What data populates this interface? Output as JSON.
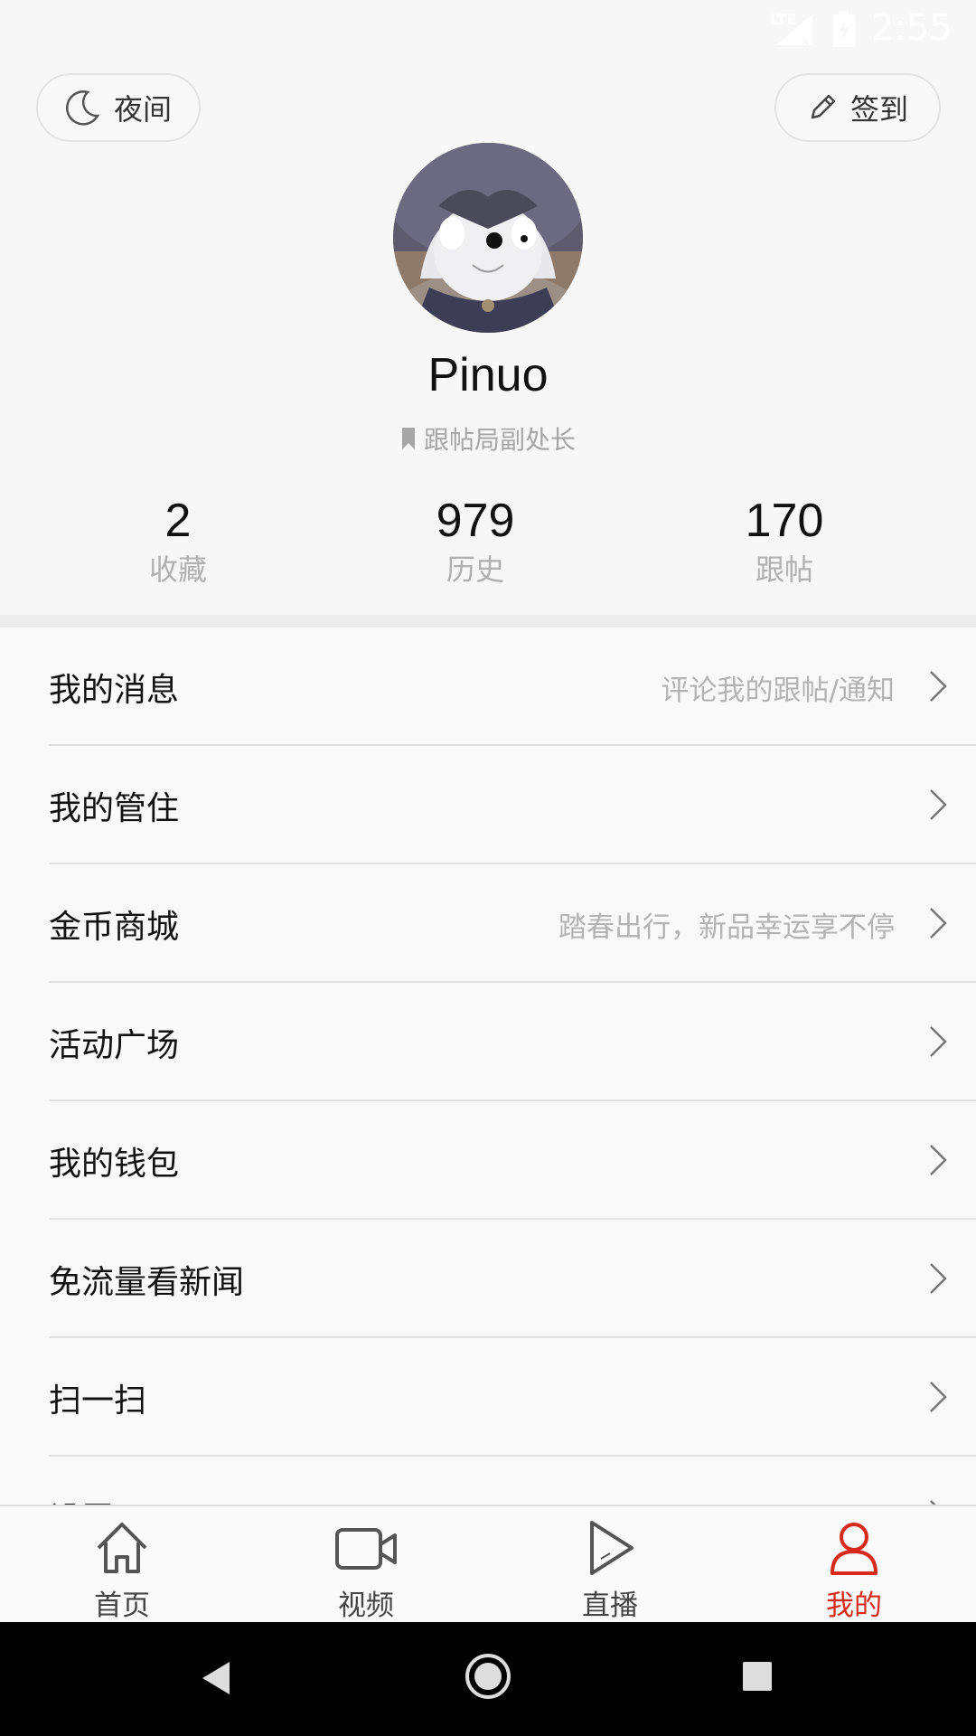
{
  "status_bar": {
    "network": "LTE",
    "time": "2:55"
  },
  "header": {
    "night_label": "夜间",
    "sign_in_label": "签到"
  },
  "profile": {
    "username": "Pinuo",
    "title": "跟帖局副处长"
  },
  "stats": [
    {
      "value": "2",
      "label": "收藏"
    },
    {
      "value": "979",
      "label": "历史"
    },
    {
      "value": "170",
      "label": "跟帖"
    }
  ],
  "menu": [
    {
      "label": "我的消息",
      "hint": "评论我的跟帖/通知"
    },
    {
      "label": "我的管住",
      "hint": ""
    },
    {
      "label": "金币商城",
      "hint": "踏春出行，新品幸运享不停"
    },
    {
      "label": "活动广场",
      "hint": ""
    },
    {
      "label": "我的钱包",
      "hint": ""
    },
    {
      "label": "免流量看新闻",
      "hint": ""
    },
    {
      "label": "扫一扫",
      "hint": ""
    },
    {
      "label": "设置",
      "hint": ""
    }
  ],
  "tabbar": [
    {
      "label": "首页",
      "icon": "home-icon"
    },
    {
      "label": "视频",
      "icon": "video-camera-icon"
    },
    {
      "label": "直播",
      "icon": "play-icon"
    },
    {
      "label": "我的",
      "icon": "person-icon",
      "active": true
    }
  ],
  "colors": {
    "accent": "#d9281c",
    "background": "#f7f7f7"
  }
}
